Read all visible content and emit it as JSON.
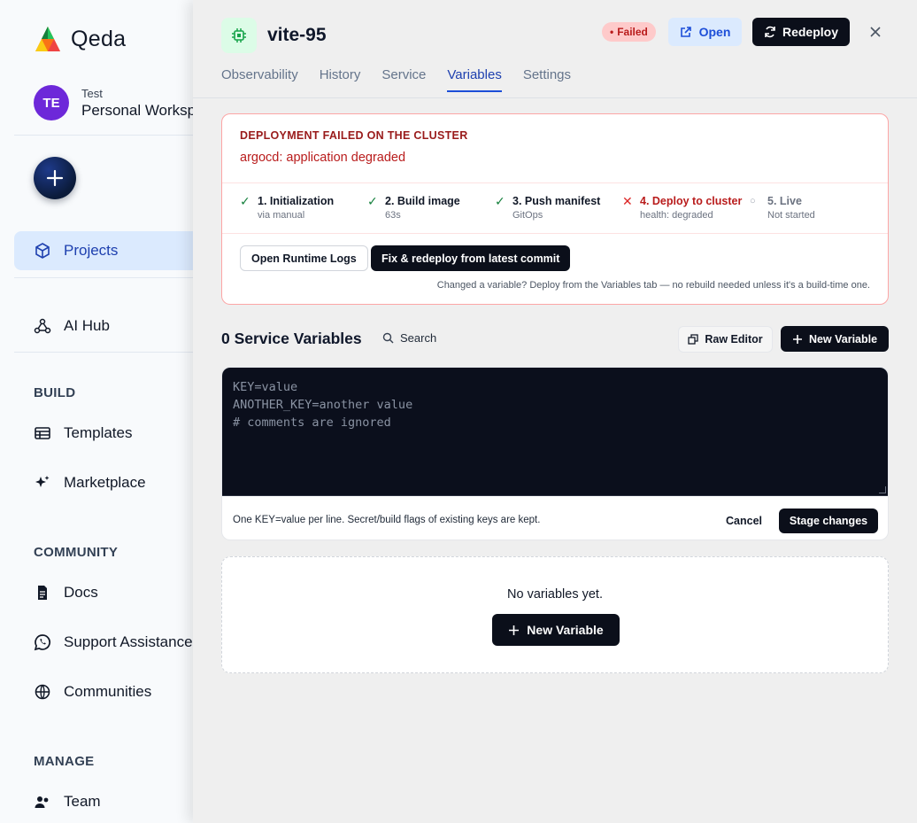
{
  "app": {
    "name": "Qeda"
  },
  "workspace": {
    "initials": "TE",
    "label": "Test",
    "name": "Personal Workspace"
  },
  "sidebar": {
    "projects": "Projects",
    "ai_hub": "AI Hub",
    "build_label": "BUILD",
    "templates": "Templates",
    "marketplace": "Marketplace",
    "community_label": "COMMUNITY",
    "docs": "Docs",
    "support": "Support Assistance",
    "communities": "Communities",
    "manage_label": "MANAGE",
    "team": "Team"
  },
  "service": {
    "name": "vite-95",
    "status": "Failed",
    "open_label": "Open",
    "redeploy_label": "Redeploy",
    "tabs": [
      "Observability",
      "History",
      "Service",
      "Variables",
      "Settings"
    ],
    "active_tab": "Variables"
  },
  "deployment": {
    "error_title": "DEPLOYMENT FAILED ON THE CLUSTER",
    "error_message": "argocd: application degraded",
    "steps": [
      {
        "title": "1. Initialization",
        "subtitle": "via manual",
        "status": "done"
      },
      {
        "title": "2. Build image",
        "subtitle": "63s",
        "status": "done"
      },
      {
        "title": "3. Push manifest",
        "subtitle": "GitOps",
        "status": "done"
      },
      {
        "title": "4. Deploy to cluster",
        "subtitle": "health: degraded",
        "status": "failed"
      },
      {
        "title": "5. Live",
        "subtitle": "Not started",
        "status": "pending"
      }
    ],
    "logs_button": "Open Runtime Logs",
    "fix_button": "Fix & redeploy from latest commit",
    "hint": "Changed a variable? Deploy from the Variables tab — no rebuild needed unless it's a build-time one."
  },
  "variables": {
    "title": "0 Service Variables",
    "search_placeholder": "Search",
    "raw_editor_label": "Raw Editor",
    "new_variable_label": "New Variable",
    "editor_lines": [
      "KEY=value",
      "ANOTHER_KEY=another value",
      "# comments are ignored"
    ],
    "editor_hint": "One KEY=value per line. Secret/build flags of existing keys are kept.",
    "cancel_label": "Cancel",
    "stage_label": "Stage changes",
    "empty_text": "No variables yet.",
    "empty_button": "New Variable"
  },
  "colors": {
    "accent": "#1d4ed8",
    "primary_button": "#0b0f1a",
    "error": "#b91c1c",
    "success": "#15803d"
  }
}
